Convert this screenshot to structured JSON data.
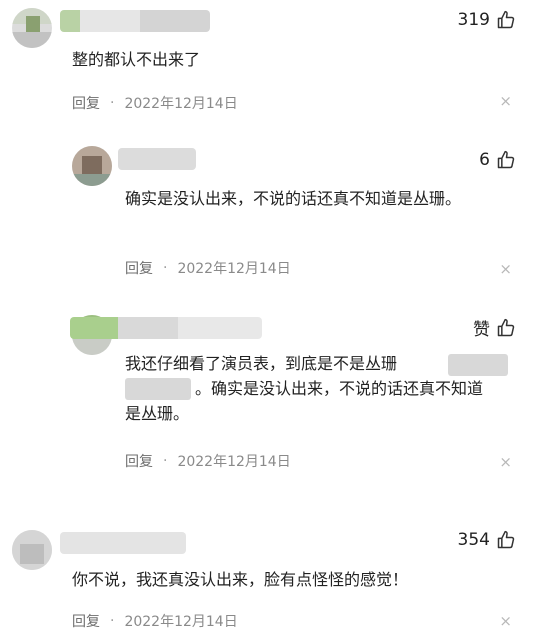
{
  "comments": [
    {
      "likes": "319",
      "text": "整的都认不出来了",
      "reply": "回复",
      "dot": "·",
      "date": "2022年12月14日",
      "close": "×"
    },
    {
      "likes": "6",
      "text": "确实是没认出来，不说的话还真不知道是丛珊。",
      "reply": "回复",
      "dot": "·",
      "date": "2022年12月14日",
      "close": "×"
    },
    {
      "likes": "赞",
      "text_line1": "我还仔细看了演员表，到底是不是丛珊",
      "text_line2": "。确实是没认出来，不说的话还真不知道",
      "text_line3": "是丛珊。",
      "reply": "回复",
      "dot": "·",
      "date": "2022年12月14日",
      "close": "×"
    },
    {
      "likes": "354",
      "text": "你不说，我还真没认出来，脸有点怪怪的感觉！",
      "reply": "回复",
      "dot": "·",
      "date": "2022年12月14日",
      "close": "×"
    }
  ],
  "icons": {
    "like": "thumbs-up-icon",
    "close": "close-icon"
  }
}
